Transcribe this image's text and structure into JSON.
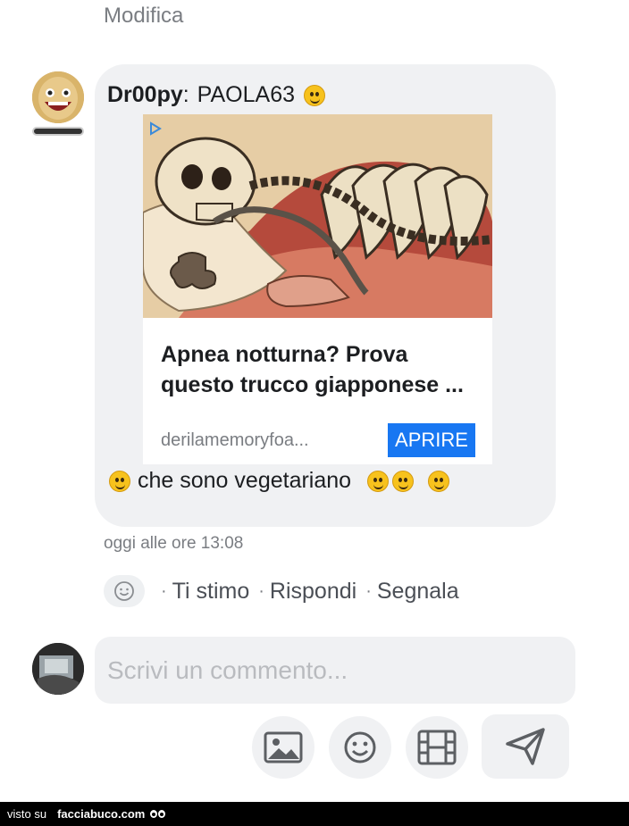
{
  "header": {
    "edit_label": "Modifica"
  },
  "comment": {
    "author": "Dr00py",
    "mention": "PAOLA63",
    "ad": {
      "title": "Apnea notturna? Prova questo trucco giapponese ...",
      "domain": "derilamemoryfoa...",
      "button_label": "APRIRE"
    },
    "text": "che sono vegetariano",
    "timestamp": "oggi alle ore 13:08",
    "actions": {
      "like_label": "Ti stimo",
      "reply_label": "Rispondi",
      "report_label": "Segnala"
    }
  },
  "composer": {
    "placeholder": "Scrivi un commento...",
    "tools": [
      "image-icon",
      "emoji-icon",
      "video-icon"
    ],
    "send_icon": "send-icon"
  },
  "footer": {
    "prefix": "visto su",
    "brand": "facciabuco.com"
  }
}
